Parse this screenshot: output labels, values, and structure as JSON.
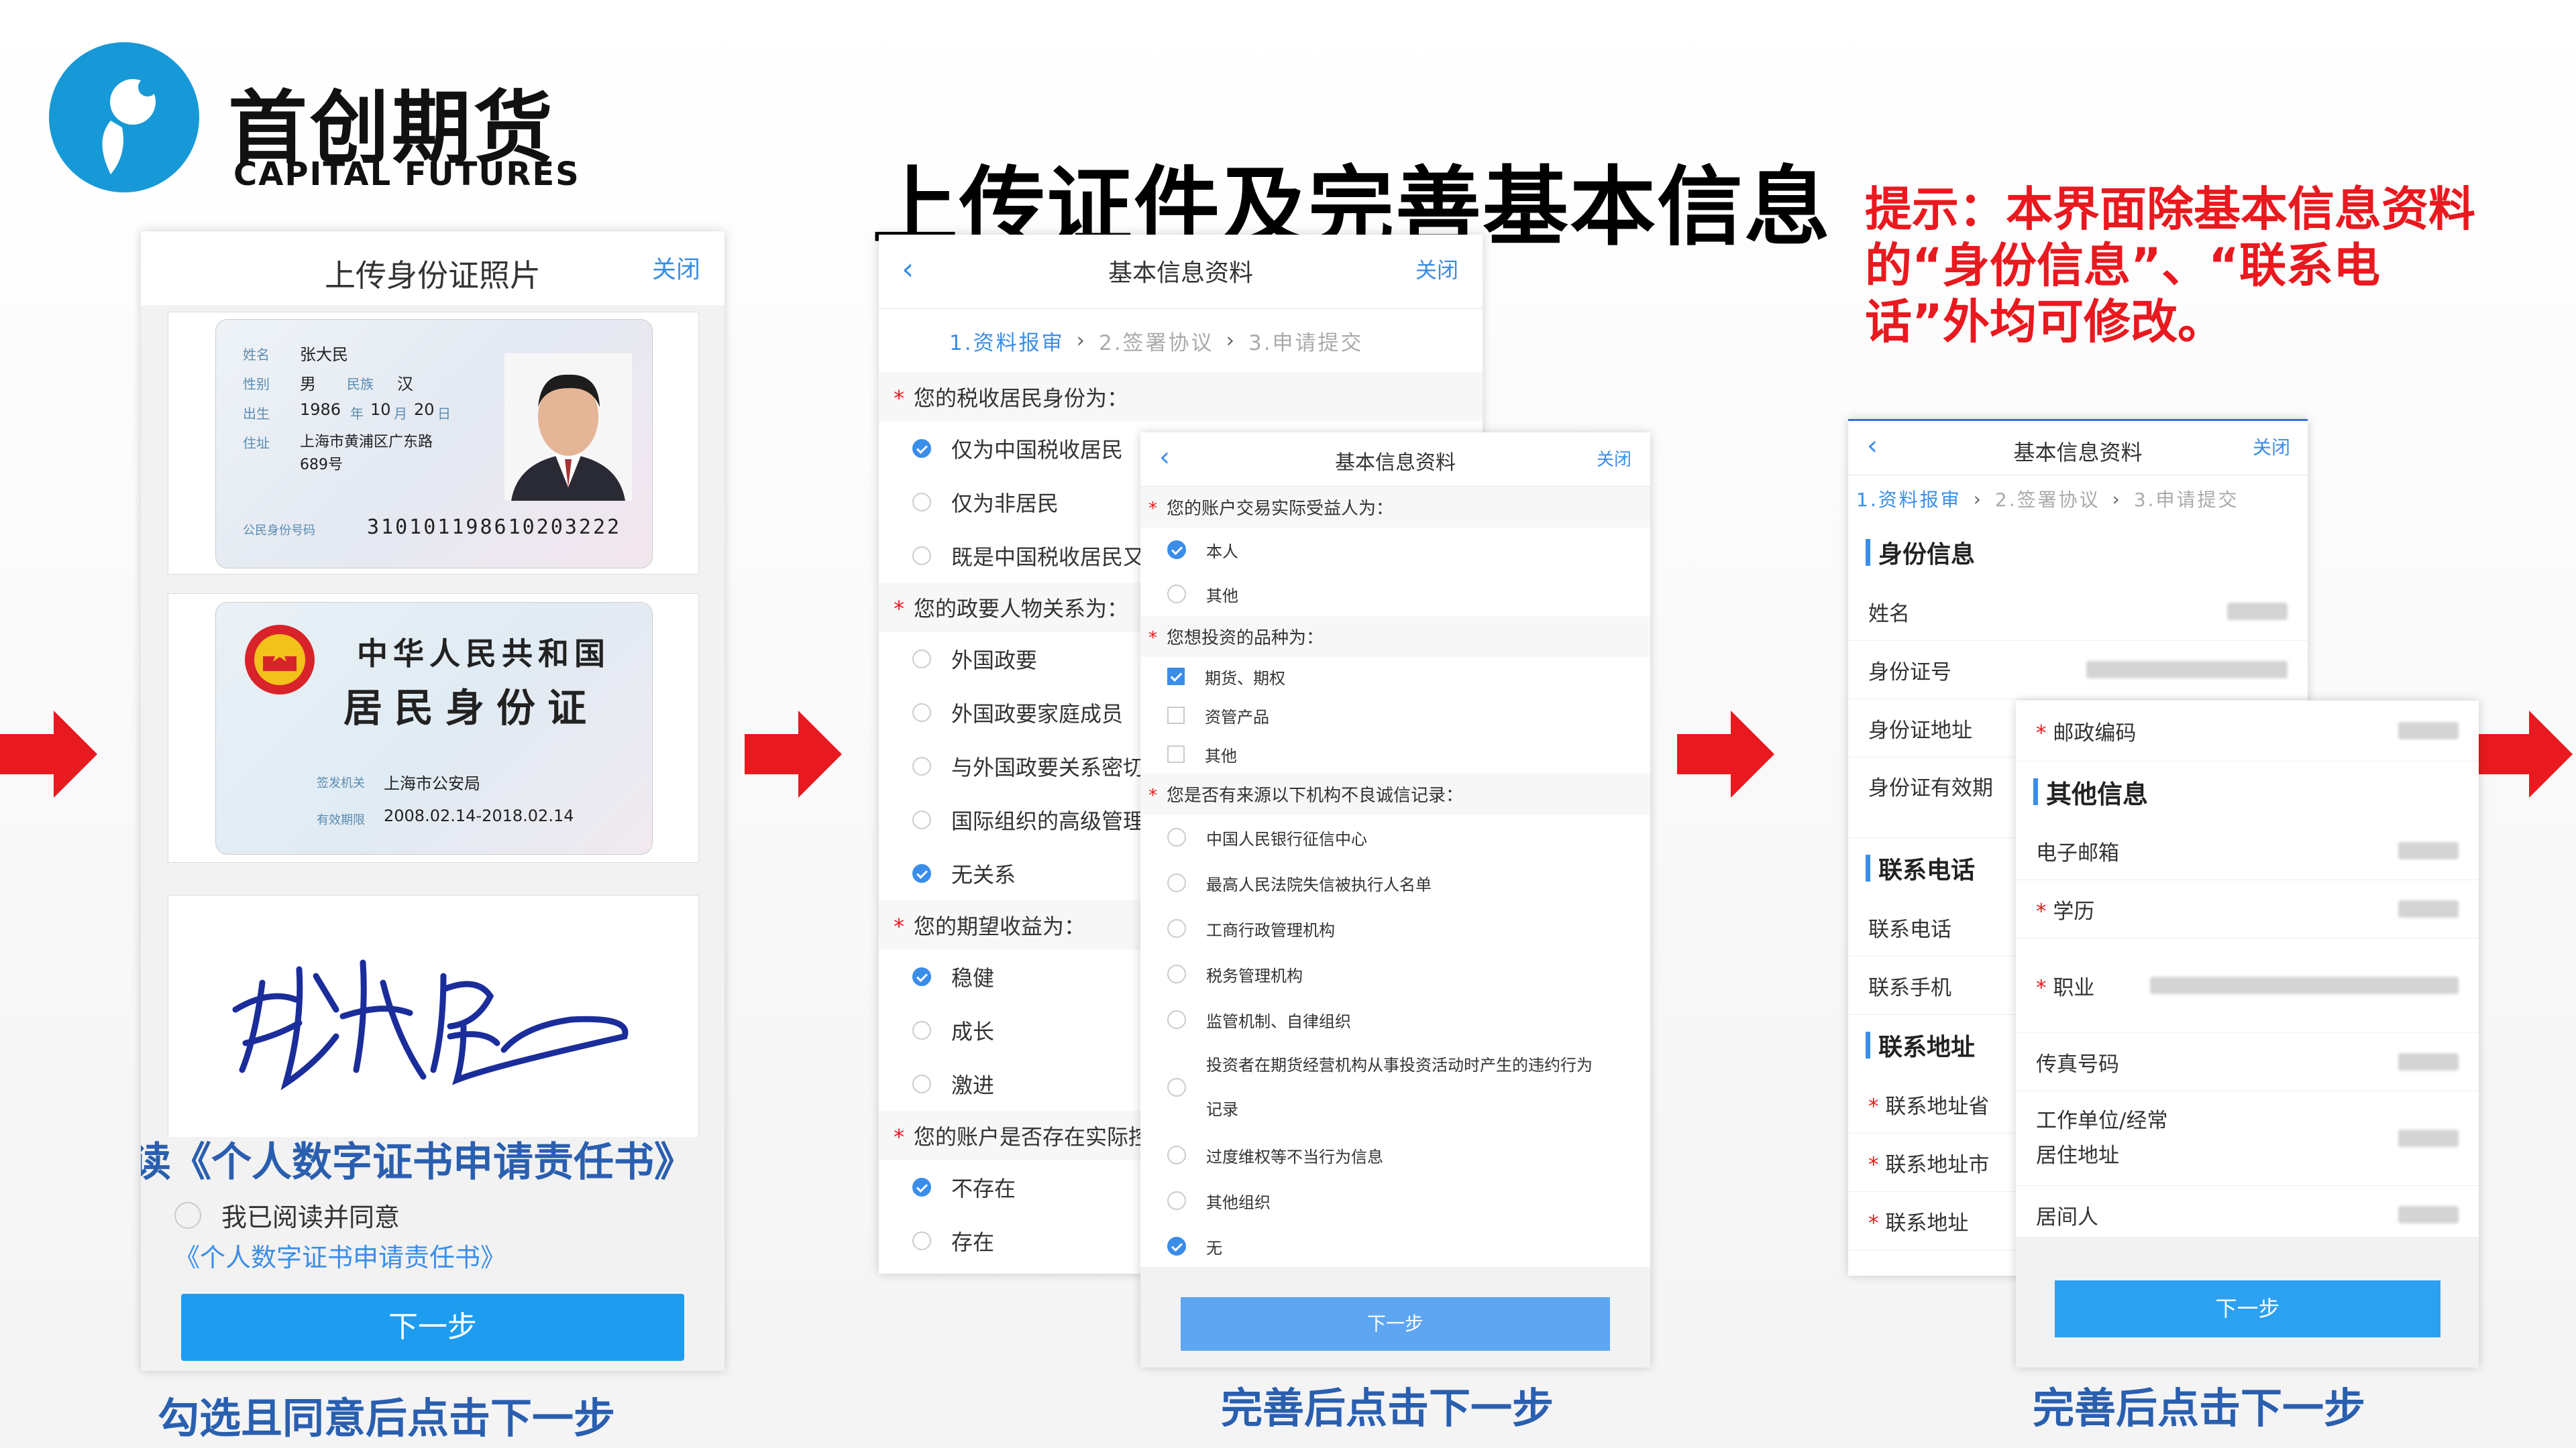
{
  "logo": {
    "cn": "首创期货",
    "en": "CAPITAL FUTURES",
    "icon": "elephant-drop-logo",
    "color": "#1799d7"
  },
  "main_title": "上传证件及完善基本信息",
  "tip": "提示：本界面除基本信息资料的“身份信息”、“联系电话”外均可修改。",
  "captions": {
    "left": "勾选且同意后点击下一步",
    "middle": "完善后点击下一步",
    "right": "完善后点击下一步"
  },
  "panel1": {
    "title": "上传身份证照片",
    "close": "关闭",
    "id_front": {
      "name_label": "姓名",
      "name": "张大民",
      "sex_label": "性别",
      "sex": "男",
      "ethnic_label": "民族",
      "ethnic": "汉",
      "birth_label": "出生",
      "birth_year": "1986",
      "birth_y": "年",
      "birth_month": "10",
      "birth_m": "月",
      "birth_day": "20",
      "birth_d": "日",
      "addr_label": "住址",
      "address1": "上海市黄浦区广东路",
      "address2": "689号",
      "id_label": "公民身份号码",
      "id_number": "310101198610203222"
    },
    "id_back": {
      "line1": "中华人民共和国",
      "line2": "居民身份证",
      "authority_label": "签发机关",
      "authority": "上海市公安局",
      "valid_label": "有效期限",
      "valid": "2008.02.14-2018.02.14"
    },
    "read_heading": "阅读《个人数字证书申请责任书》",
    "agree": "我已阅读并同意",
    "agree_link": "《个人数字证书申请责任书》",
    "next": "下一步"
  },
  "panel2": {
    "back": "‹",
    "title": "基本信息资料",
    "close": "关闭",
    "steps": [
      "1.资料报审",
      "2.签署协议",
      "3.申请提交"
    ],
    "q1": "您的税收居民身份为：",
    "q1_opts": [
      {
        "label": "仅为中国税收居民",
        "checked": true
      },
      {
        "label": "仅为非居民",
        "checked": false
      },
      {
        "label": "既是中国税收居民又",
        "checked": false
      }
    ],
    "q2": "您的政要人物关系为：",
    "q2_opts": [
      {
        "label": "外国政要",
        "checked": false
      },
      {
        "label": "外国政要家庭成员",
        "checked": false
      },
      {
        "label": "与外国政要关系密切",
        "checked": false
      },
      {
        "label": "国际组织的高级管理",
        "checked": false
      },
      {
        "label": "无关系",
        "checked": true
      }
    ],
    "q3": "您的期望收益为：",
    "q3_opts": [
      {
        "label": "稳健",
        "checked": true
      },
      {
        "label": "成长",
        "checked": false
      },
      {
        "label": "激进",
        "checked": false
      }
    ],
    "q4": "您的账户是否存在实际控",
    "q4_opts": [
      {
        "label": "不存在",
        "checked": true
      },
      {
        "label": "存在",
        "checked": false
      }
    ]
  },
  "panel3": {
    "back": "‹",
    "title": "基本信息资料",
    "close": "关闭",
    "q1": "您的账户交易实际受益人为：",
    "q1_opts": [
      {
        "label": "本人",
        "checked": true
      },
      {
        "label": "其他",
        "checked": false
      }
    ],
    "q2": "您想投资的品种为：",
    "q2_opts": [
      {
        "label": "期货、期权",
        "checked": true
      },
      {
        "label": "资管产品",
        "checked": false
      },
      {
        "label": "其他",
        "checked": false
      }
    ],
    "q3": "您是否有来源以下机构不良诚信记录：",
    "q3_opts": [
      {
        "label": "中国人民银行征信中心",
        "checked": false
      },
      {
        "label": "最高人民法院失信被执行人名单",
        "checked": false
      },
      {
        "label": "工商行政管理机构",
        "checked": false
      },
      {
        "label": "税务管理机构",
        "checked": false
      },
      {
        "label": "监管机制、自律组织",
        "checked": false
      },
      {
        "label": "投资者在期货经营机构从事投资活动时产生的违约行为",
        "label2": "记录",
        "checked": false
      },
      {
        "label": "过度维权等不当行为信息",
        "checked": false
      },
      {
        "label": "其他组织",
        "checked": false
      },
      {
        "label": "无",
        "checked": true
      }
    ],
    "next": "下一步"
  },
  "panel4": {
    "back": "‹",
    "title": "基本信息资料",
    "close": "关闭",
    "steps": [
      "1.资料报审",
      "2.签署协议",
      "3.申请提交"
    ],
    "sect_identity": "身份信息",
    "identity_rows": [
      "姓名",
      "身份证号",
      "身份证地址",
      "身份证有效期"
    ],
    "sect_phone": "联系电话",
    "phone_rows": [
      "联系电话",
      "联系手机"
    ],
    "sect_addr": "联系地址",
    "addr_rows": [
      "联系地址省",
      "联系地址市",
      "联系地址"
    ]
  },
  "panel5": {
    "postcode": "邮政编码",
    "sect_other": "其他信息",
    "rows": [
      "电子邮箱",
      "学历",
      "职业",
      "传真号码",
      "工作单位/经常",
      "居住地址",
      "居间人"
    ],
    "next": "下一步"
  }
}
